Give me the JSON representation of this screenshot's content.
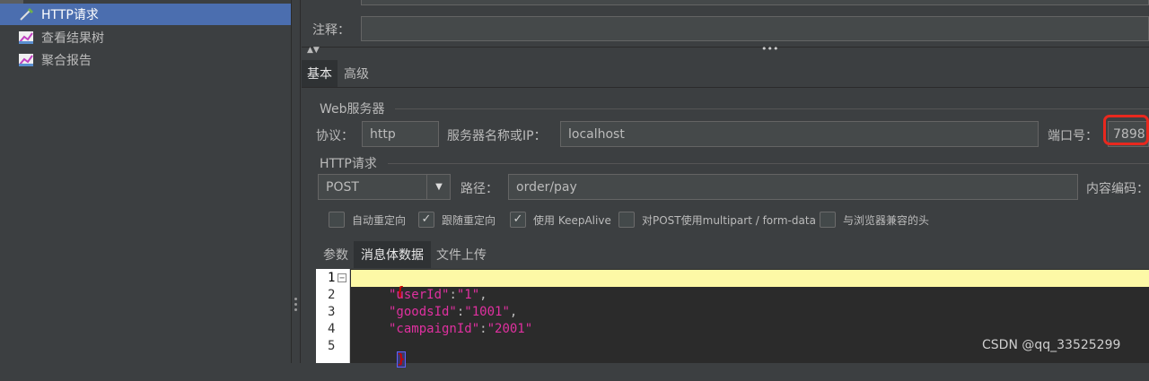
{
  "tree": {
    "items": [
      {
        "label": "HTTP请求",
        "selected": true,
        "icon": "pipette-icon"
      },
      {
        "label": "查看结果树",
        "selected": false,
        "icon": "graph-listener-icon"
      },
      {
        "label": "聚合报告",
        "selected": false,
        "icon": "graph-listener-icon"
      }
    ]
  },
  "form": {
    "comment_label": "注释：",
    "comment_value": "",
    "tabs": [
      "基本",
      "高级"
    ],
    "web_server": {
      "legend": "Web服务器",
      "protocol_label": "协议：",
      "protocol_value": "http",
      "server_label": "服务器名称或IP：",
      "server_value": "localhost",
      "port_label": "端口号：",
      "port_value": "7898"
    },
    "http_request": {
      "legend": "HTTP请求",
      "method_value": "POST",
      "path_label": "路径：",
      "path_value": "order/pay",
      "encoding_label": "内容编码："
    },
    "checkboxes": [
      {
        "label": "自动重定向",
        "checked": false
      },
      {
        "label": "跟随重定向",
        "checked": true
      },
      {
        "label": "使用 KeepAlive",
        "checked": true
      },
      {
        "label": "对POST使用multipart / form-data",
        "checked": false
      },
      {
        "label": "与浏览器兼容的头",
        "checked": false
      }
    ],
    "body_tabs": [
      "参数",
      "消息体数据",
      "文件上传"
    ],
    "editor": {
      "line_numbers": [
        "1",
        "2",
        "3",
        "4",
        "5"
      ],
      "lines": [
        {
          "open": "{"
        },
        {
          "key": "\"userId\"",
          "colon": ":",
          "value": "\"1\"",
          "comma": ","
        },
        {
          "key": "\"goodsId\"",
          "colon": ":",
          "value": "\"1001\"",
          "comma": ","
        },
        {
          "key": "\"campaignId\"",
          "colon": ":",
          "value": "\"2001\"",
          "comma": ""
        },
        {
          "close": "}"
        }
      ]
    }
  },
  "watermark": "CSDN @qq_33525299",
  "colors": {
    "selection": "#4b6eaf",
    "highlight_line": "#fdf9a6",
    "string_magenta": "#e030a0",
    "brace_red": "#d00000",
    "annotation_red": "#e8281e"
  }
}
